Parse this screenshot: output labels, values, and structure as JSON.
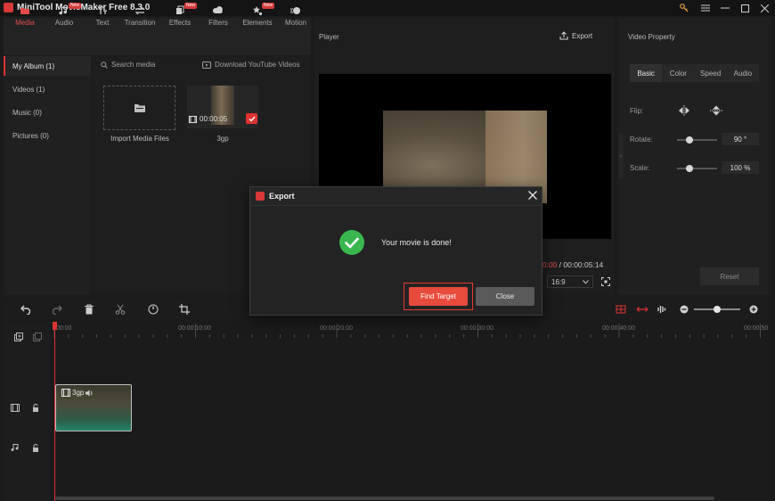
{
  "app": {
    "title": "MiniTool MovieMaker Free 8.3.0",
    "window_controls": [
      "key-icon",
      "menu-icon",
      "minimize-icon",
      "maximize-icon",
      "close-icon"
    ]
  },
  "toolbar": {
    "tabs": [
      {
        "label": "Media",
        "icon": "media-icon",
        "active": true,
        "new": false
      },
      {
        "label": "Audio",
        "icon": "audio-icon",
        "active": false,
        "new": true
      },
      {
        "label": "Text",
        "icon": "text-icon",
        "active": false,
        "new": false
      },
      {
        "label": "Transition",
        "icon": "transition-icon",
        "active": false,
        "new": false
      },
      {
        "label": "Effects",
        "icon": "effects-icon",
        "active": false,
        "new": true
      },
      {
        "label": "Filters",
        "icon": "filters-icon",
        "active": false,
        "new": false
      },
      {
        "label": "Elements",
        "icon": "elements-icon",
        "active": false,
        "new": true
      },
      {
        "label": "Motion",
        "icon": "motion-icon",
        "active": false,
        "new": false
      }
    ],
    "new_badge": "New"
  },
  "sidebar": {
    "items": [
      {
        "label": "My Album  (1)",
        "active": true
      },
      {
        "label": "Videos  (1)",
        "active": false
      },
      {
        "label": "Music  (0)",
        "active": false
      },
      {
        "label": "Pictures  (0)",
        "active": false
      }
    ]
  },
  "media": {
    "search_placeholder": "Search media",
    "download_label": "Download YouTube Videos",
    "import_label": "Import Media Files",
    "item": {
      "duration": "00:00:05",
      "name": "3gp"
    }
  },
  "player": {
    "title": "Player",
    "export_label": "Export",
    "time_current": "00:00",
    "time_separator": " / ",
    "time_total": "00:00:05:14",
    "aspect_ratio": "16:9"
  },
  "properties": {
    "title": "Video Property",
    "tabs": [
      "Basic",
      "Color",
      "Speed",
      "Audio"
    ],
    "active_tab": "Basic",
    "flip_label": "Flip:",
    "rotate_label": "Rotate:",
    "rotate_value": "90 °",
    "rotate_level": 0.3,
    "scale_label": "Scale:",
    "scale_value": "100 %",
    "scale_level": 0.3,
    "reset_label": "Reset"
  },
  "timeline": {
    "ruler": [
      "00:00",
      "00:00:10:00",
      "00:00:20:00",
      "00:00:30:00",
      "00:00:40:00",
      "00:00:50"
    ],
    "clip_label": "3gp",
    "zoom_level": 0.5
  },
  "dialog": {
    "title": "Export",
    "message": "Your movie is done!",
    "find_target_label": "Find Target",
    "close_label": "Close"
  },
  "colors": {
    "accent": "#e84a3c",
    "success": "#3ab64f",
    "background": "#1b1b1b"
  }
}
